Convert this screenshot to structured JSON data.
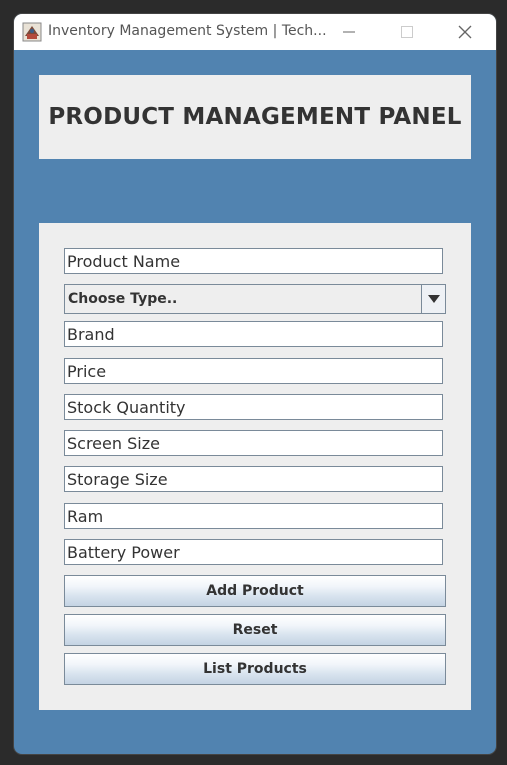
{
  "window": {
    "title": "Inventory Management System | Tech...",
    "icons": {
      "app": "app-icon",
      "minimize": "minimize-icon",
      "maximize": "maximize-icon",
      "close": "close-icon"
    }
  },
  "header": {
    "title": "PRODUCT MANAGEMENT PANEL"
  },
  "form": {
    "product_name": "Product Name",
    "type_select": {
      "selected": "Choose Type..",
      "icon": "chevron-down-icon"
    },
    "brand": "Brand",
    "price": "Price",
    "stock_quantity": "Stock Quantity",
    "screen_size": "Screen Size",
    "storage_size": "Storage Size",
    "ram": "Ram",
    "battery_power": "Battery Power"
  },
  "buttons": {
    "add": "Add Product",
    "reset": "Reset",
    "list": "List Products"
  },
  "colors": {
    "frame": "#5183b0",
    "panel": "#eeeeee",
    "titlebar": "#ffffff",
    "text": "#333333"
  }
}
